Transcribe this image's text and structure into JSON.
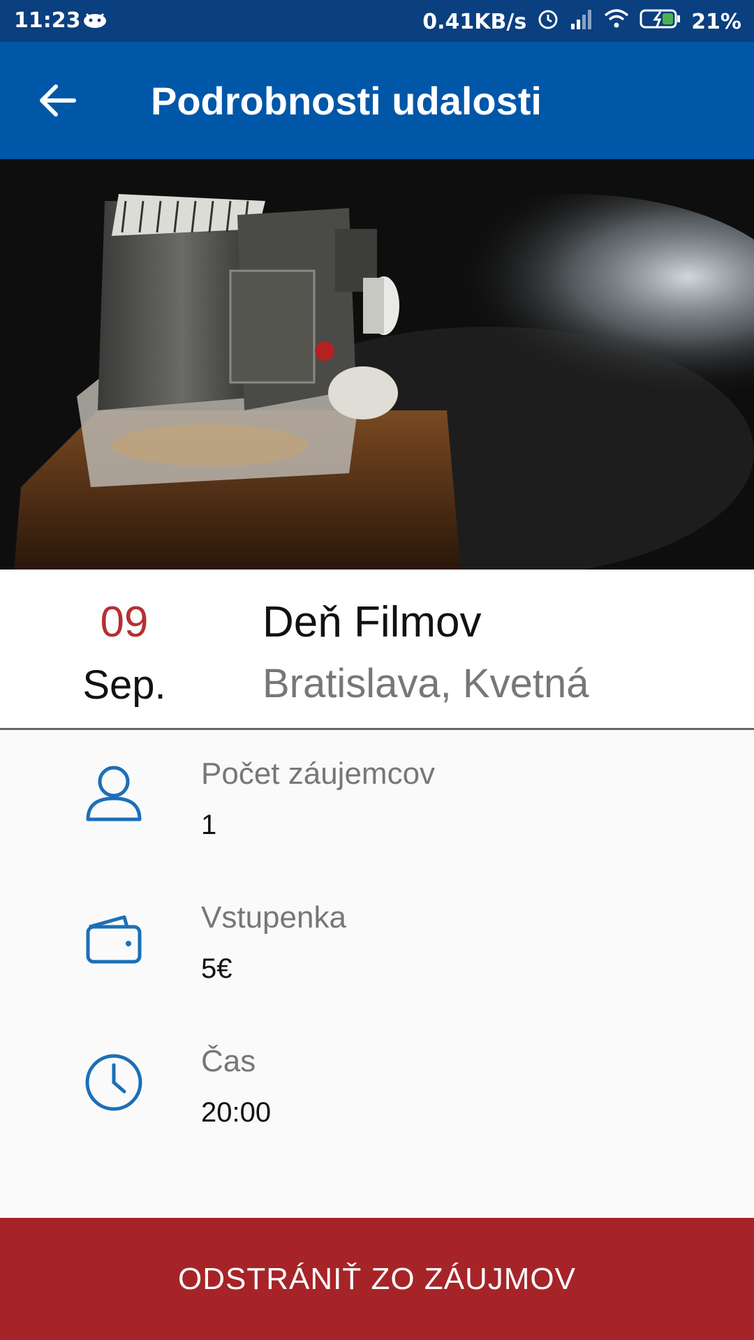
{
  "status_bar": {
    "time": "11:23",
    "net_speed": "0.41KB/s",
    "battery": "21%"
  },
  "appbar": {
    "title": "Podrobnosti udalosti"
  },
  "event": {
    "day": "09",
    "month": "Sep.",
    "title": "Deň Filmov",
    "place": "Bratislava, Kvetná"
  },
  "details": [
    {
      "label": "Počet záujemcov",
      "value": "1",
      "icon": "person-icon"
    },
    {
      "label": "Vstupenka",
      "value": "5€",
      "icon": "wallet-icon"
    },
    {
      "label": "Čas",
      "value": "20:00",
      "icon": "clock-icon"
    }
  ],
  "action": {
    "label": "ODSTRÁNIŤ ZO ZÁUJMOV"
  },
  "colors": {
    "status": "#0a3f80",
    "appbar": "#0057a8",
    "accent_red": "#b53032",
    "button": "#a62428",
    "icon_blue": "#1c6fb8"
  }
}
